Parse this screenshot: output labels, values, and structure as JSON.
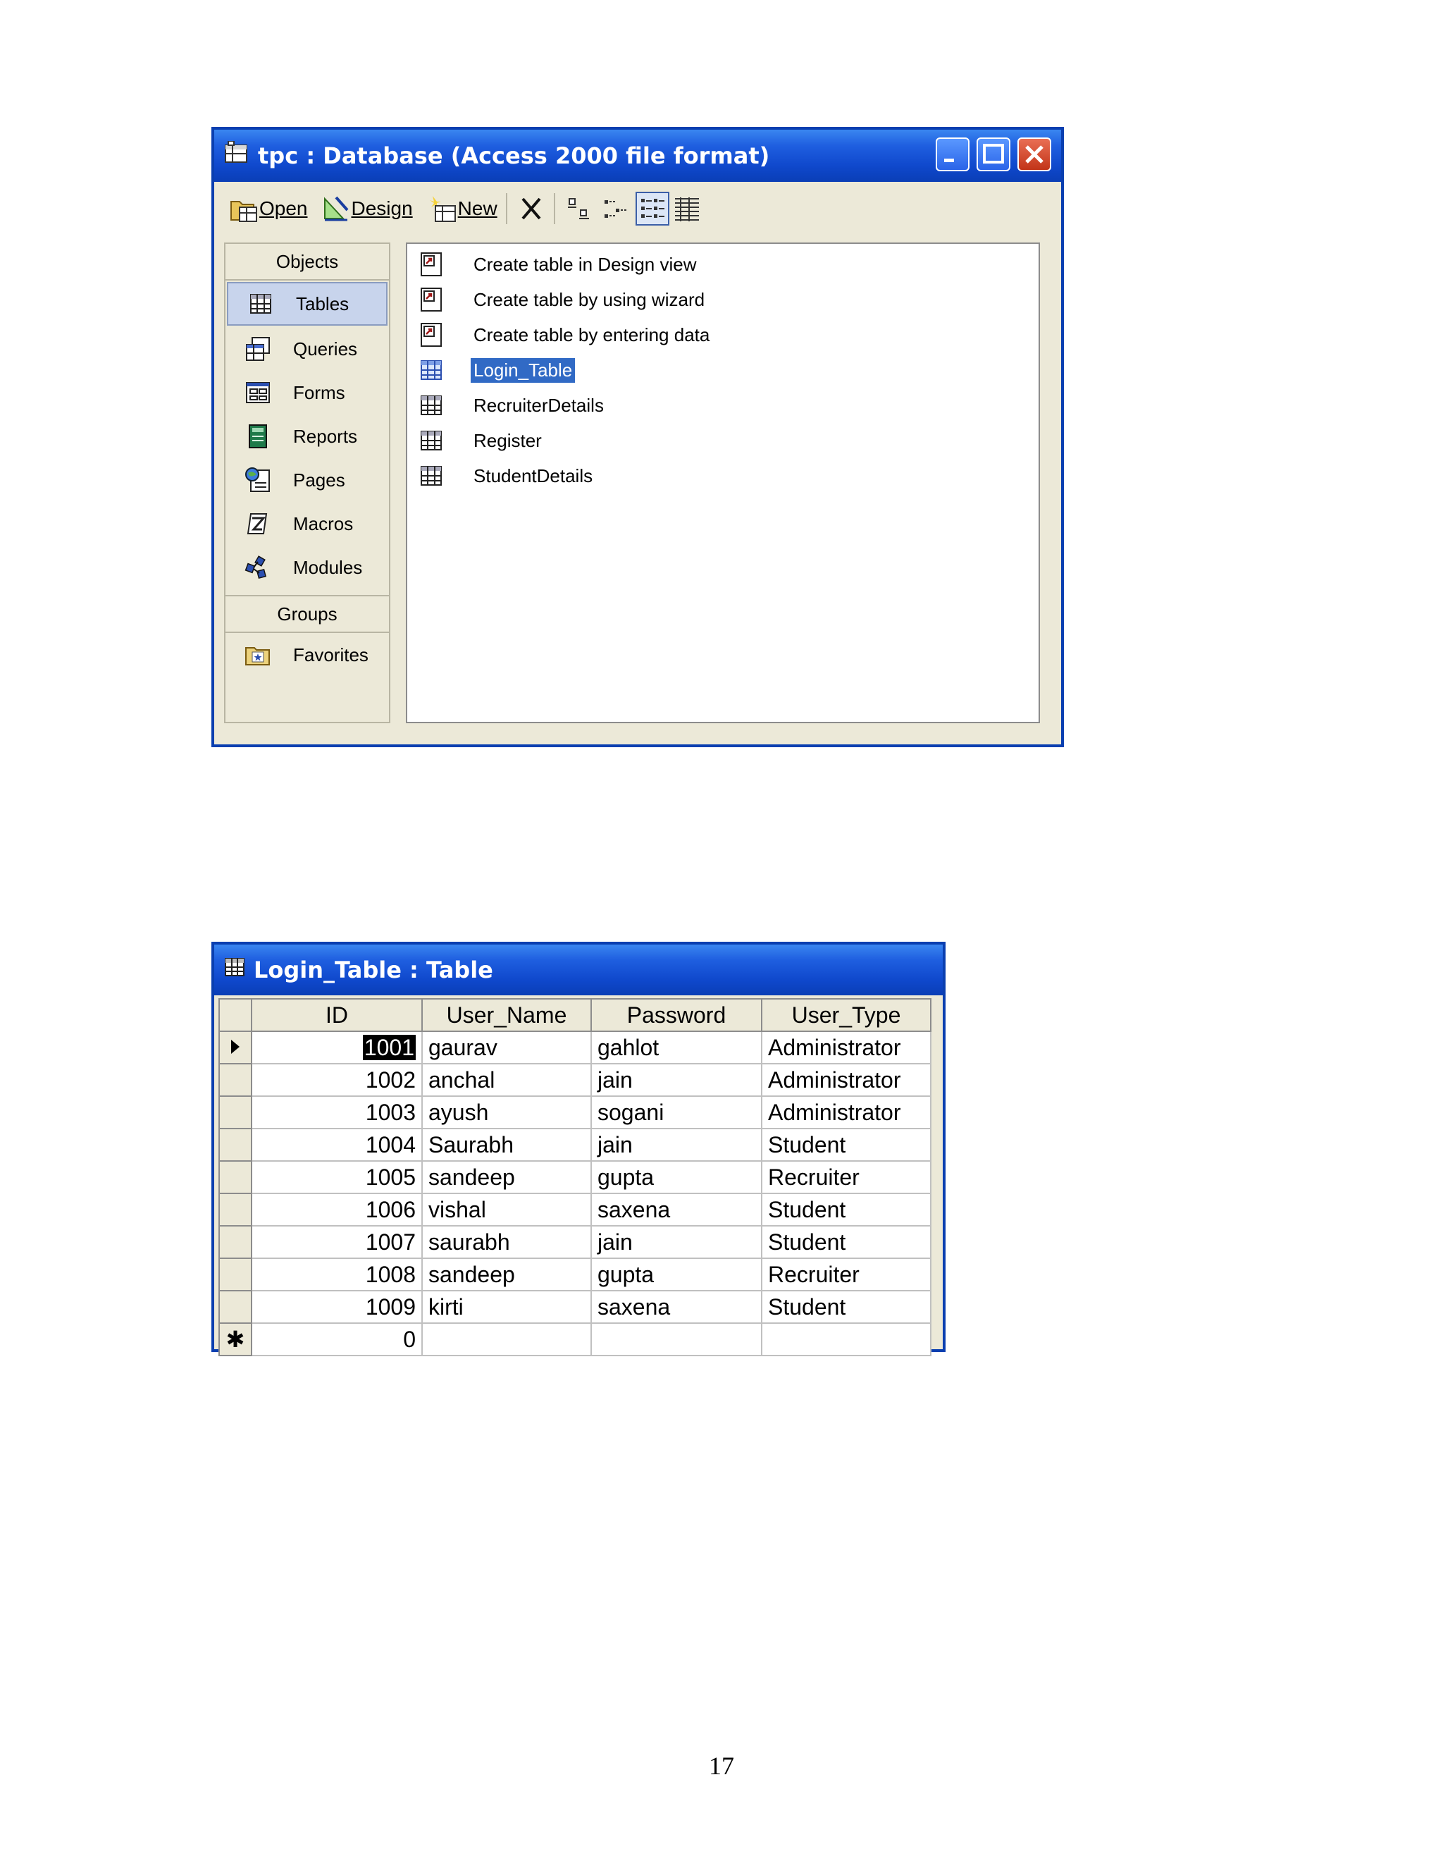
{
  "db_window": {
    "title": "tpc : Database (Access 2000 file format)",
    "toolbar": {
      "open_label": "Open",
      "design_label": "Design",
      "new_label": "New"
    },
    "objects_header": "Objects",
    "groups_header": "Groups",
    "objects": [
      {
        "label": "Tables",
        "icon": "table-icon",
        "selected": true
      },
      {
        "label": "Queries",
        "icon": "query-icon"
      },
      {
        "label": "Forms",
        "icon": "form-icon"
      },
      {
        "label": "Reports",
        "icon": "report-icon"
      },
      {
        "label": "Pages",
        "icon": "page-icon"
      },
      {
        "label": "Macros",
        "icon": "macro-icon"
      },
      {
        "label": "Modules",
        "icon": "module-icon"
      }
    ],
    "groups": [
      {
        "label": "Favorites",
        "icon": "favorites-folder-icon"
      }
    ],
    "items": [
      {
        "label": "Create table in Design view",
        "icon": "shortcut-icon"
      },
      {
        "label": "Create table by using wizard",
        "icon": "shortcut-icon"
      },
      {
        "label": "Create table by entering data",
        "icon": "shortcut-icon"
      },
      {
        "label": "Login_Table",
        "icon": "table-icon",
        "selected": true
      },
      {
        "label": "RecruiterDetails",
        "icon": "table-icon"
      },
      {
        "label": "Register",
        "icon": "table-icon"
      },
      {
        "label": "StudentDetails",
        "icon": "table-icon"
      }
    ]
  },
  "table_window": {
    "title": "Login_Table : Table",
    "columns": [
      "ID",
      "User_Name",
      "Password",
      "User_Type"
    ],
    "rows": [
      [
        "1001",
        "gaurav",
        "gahlot",
        "Administrator"
      ],
      [
        "1002",
        "anchal",
        "jain",
        "Administrator"
      ],
      [
        "1003",
        "ayush",
        "sogani",
        "Administrator"
      ],
      [
        "1004",
        "Saurabh",
        "jain",
        "Student"
      ],
      [
        "1005",
        "sandeep",
        "gupta",
        "Recruiter"
      ],
      [
        "1006",
        "vishal",
        "saxena",
        "Student"
      ],
      [
        "1007",
        "saurabh",
        "jain",
        "Student"
      ],
      [
        "1008",
        "sandeep",
        "gupta",
        "Recruiter"
      ],
      [
        "1009",
        "kirti",
        "saxena",
        "Student"
      ]
    ],
    "new_row": {
      "marker": "✱",
      "id": "0"
    }
  },
  "page_number": "17",
  "colors": {
    "title_bar": "#0f48cc",
    "selection": "#316ac5",
    "window_bg": "#ece9d8"
  }
}
